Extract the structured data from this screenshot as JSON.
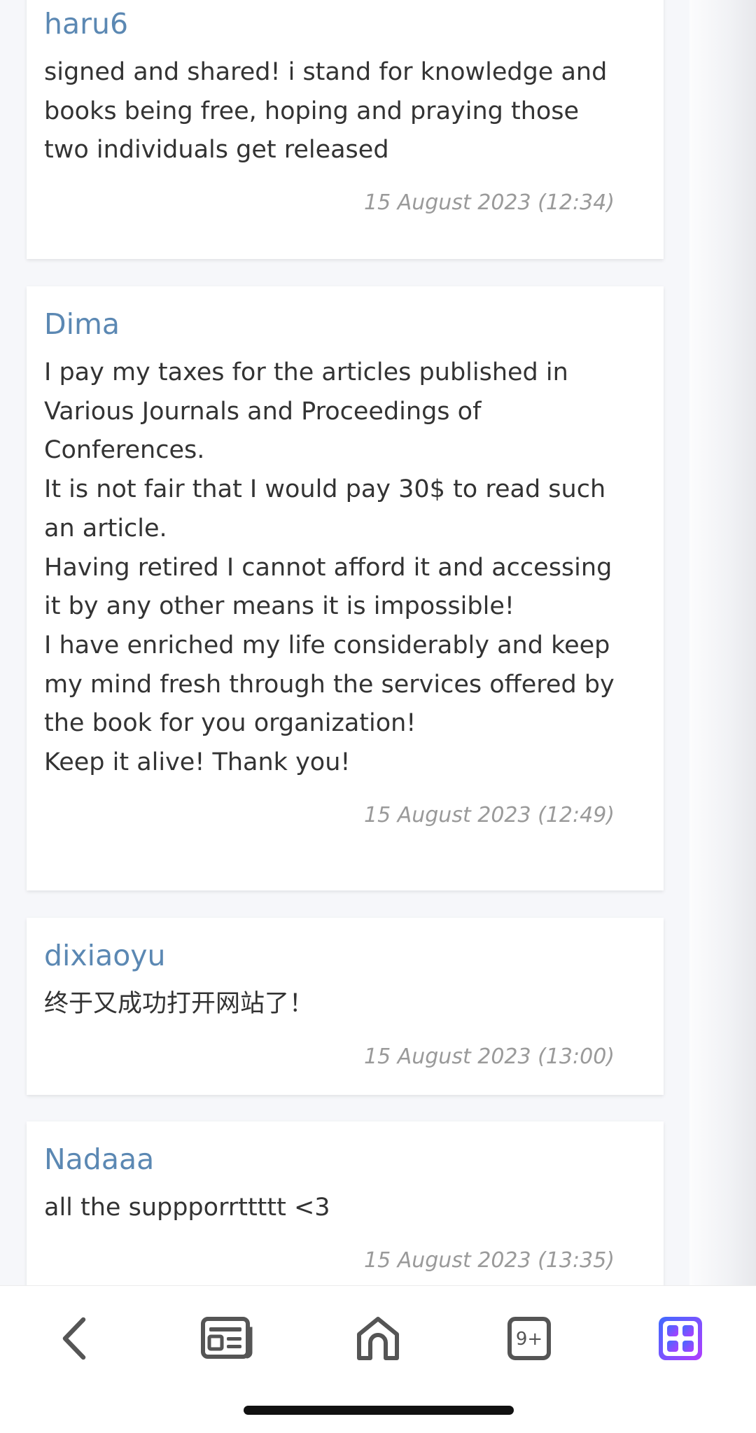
{
  "comments": [
    {
      "author": "haru6",
      "text": "signed and shared! i stand for knowledge and books being free, hoping and praying those two individuals get released",
      "timestamp": "15 August 2023 (12:34)"
    },
    {
      "author": "Dima",
      "text": "I pay my taxes for the articles published in Various Journals and Proceedings of Conferences.\nIt is not fair that I would pay 30$ to read such an article.\nHaving retired I cannot afford it and accessing it by any other means it is impossible!\nI have enriched my life considerably and keep my mind fresh through the services offered by the book for you organization!\nKeep it alive! Thank you!",
      "timestamp": "15 August 2023 (12:49)"
    },
    {
      "author": "dixiaoyu",
      "text": "终于又成功打开网站了！",
      "timestamp": "15 August 2023 (13:00)"
    },
    {
      "author": "Nadaaa",
      "text": "all the suppporrttttt <3",
      "timestamp": "15 August 2023 (13:35)"
    }
  ],
  "bottom_nav": {
    "tabs_count": "9+",
    "icons": [
      "back-arrow-icon",
      "news-icon",
      "home-icon",
      "tabs-icon",
      "apps-grid-icon"
    ]
  },
  "colors": {
    "author": "#5b88b3",
    "body_text": "#333333",
    "timestamp": "#9a9a9a",
    "apps_gradient_start": "#3f6bff",
    "apps_gradient_end": "#b23cff"
  }
}
